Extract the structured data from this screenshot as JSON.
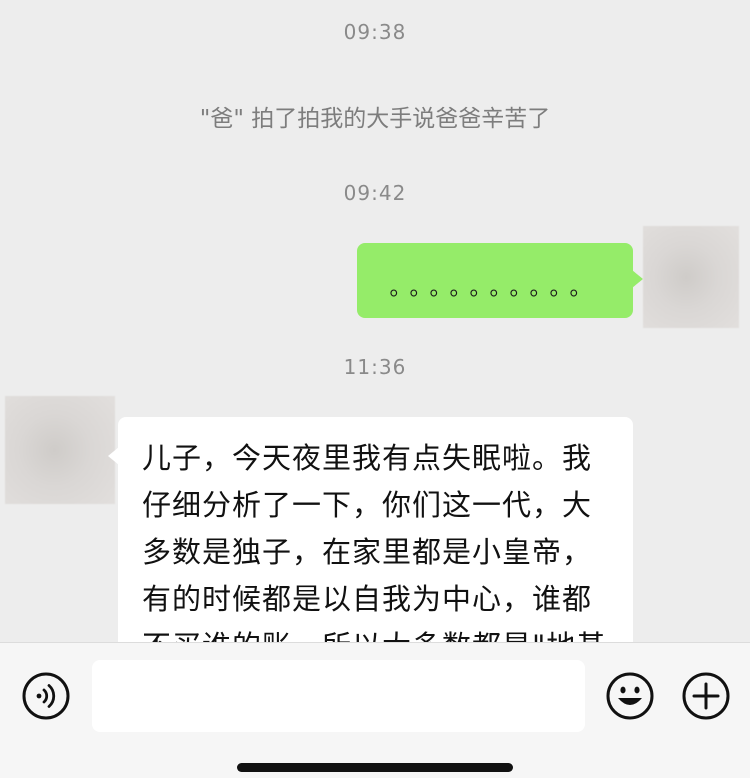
{
  "chat": {
    "messages": [
      {
        "type": "time",
        "text": "09:38"
      },
      {
        "type": "system",
        "text": "\"爸\" 拍了拍我的大手说爸爸辛苦了"
      },
      {
        "type": "time",
        "text": "09:42"
      },
      {
        "type": "bubble",
        "side": "right",
        "color": "#95ec69",
        "text": "。。。。。。。。。。"
      },
      {
        "type": "time",
        "text": "11:36"
      },
      {
        "type": "bubble",
        "side": "left",
        "color": "#ffffff",
        "text": "儿子，今天夜里我有点失眠啦。我仔细分析了一下，你们这一代，大多数是独子，在家里都是小皇帝，有的时候都是以自我为中心，谁都不买谁的账，所以大多数都是\"地基"
      }
    ]
  },
  "input_bar": {
    "voice_icon": "voice-icon",
    "input_value": "",
    "emoji_icon": "emoji-icon",
    "plus_icon": "plus-icon"
  },
  "colors": {
    "background": "#ededed",
    "sent_bubble": "#95ec69",
    "received_bubble": "#ffffff",
    "timestamp": "#8a8a8a"
  }
}
